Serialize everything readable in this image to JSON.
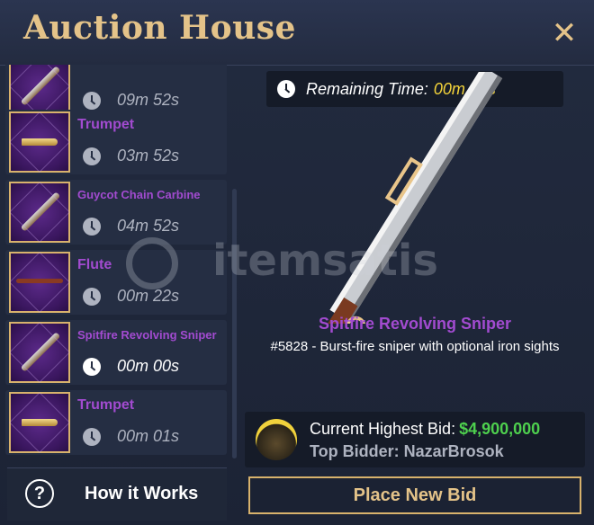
{
  "header": {
    "title": "Auction House",
    "close_icon": "close-icon"
  },
  "listings": [
    {
      "name": "",
      "time": "09m 52s",
      "icon": "gun-icon",
      "active": false
    },
    {
      "name": "Trumpet",
      "time": "03m 52s",
      "icon": "trumpet-icon",
      "active": false
    },
    {
      "name": "Guycot Chain Carbine",
      "time": "04m 52s",
      "icon": "rifle-icon",
      "active": false
    },
    {
      "name": "Flute",
      "time": "00m 22s",
      "icon": "flute-icon",
      "active": false
    },
    {
      "name": "Spitfire Revolving Sniper",
      "time": "00m 00s",
      "icon": "sniper-icon",
      "active": true
    },
    {
      "name": "Trumpet",
      "time": "00m 01s",
      "icon": "trumpet-icon",
      "active": false
    }
  ],
  "how_it_works": {
    "label": "How it Works",
    "icon_glyph": "?"
  },
  "remaining": {
    "label": "Remaining Time:",
    "value": "00m 00s"
  },
  "featured": {
    "name": "Spitfire Revolving Sniper",
    "description": "#5828 - Burst-fire sniper with optional iron sights",
    "icon": "sniper-rifle-icon"
  },
  "bid": {
    "label": "Current Highest Bid:",
    "value": "$4,900,000",
    "bidder_label": "Top Bidder: NazarBrosok"
  },
  "place_bid_label": "Place New Bid",
  "watermark": "itemsatis",
  "colors": {
    "gold": "#e4c389",
    "purple": "#a24bd0",
    "green": "#4ed04e",
    "yellow": "#f3d33a",
    "panel": "#252e43"
  }
}
